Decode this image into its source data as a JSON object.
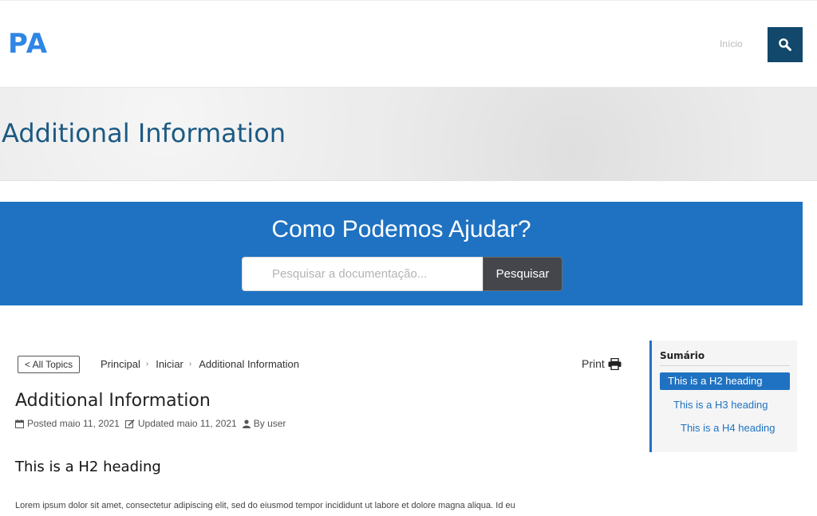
{
  "header": {
    "logo": "PA",
    "nav_home": "Início"
  },
  "banner": {
    "title": "Additional Information"
  },
  "help": {
    "title": "Como Podemos Ajudar?",
    "placeholder": "Pesquisar a documentação...",
    "submit": "Pesquisar"
  },
  "breadcrumb": {
    "all_topics": "< All Topics",
    "items": [
      "Principal",
      "Iniciar",
      "Additional Information"
    ]
  },
  "print": "Print",
  "article": {
    "title": "Additional Information",
    "posted": "Posted maio 11, 2021",
    "updated": "Updated maio 11, 2021",
    "author": "By user",
    "h2": "This is a H2 heading",
    "body": "Lorem ipsum dolor sit amet, consectetur adipiscing elit, sed do eiusmod tempor incididunt ut labore et dolore magna aliqua. Id eu"
  },
  "toc": {
    "title": "Sumário",
    "items": [
      "This is a H2 heading",
      "This is a H3 heading",
      "This is a H4 heading"
    ]
  },
  "colors": {
    "brand_blue": "#1f72c2",
    "dark_navy": "#12486b",
    "logo_blue": "#2f86e4"
  }
}
